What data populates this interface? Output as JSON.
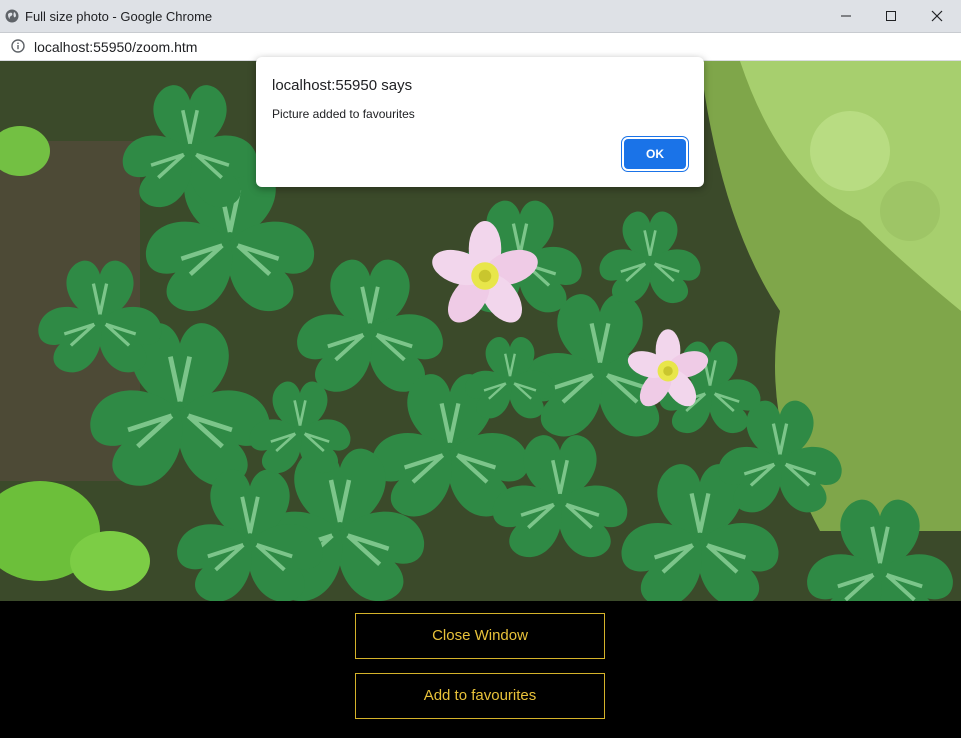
{
  "window": {
    "title": "Full size photo - Google Chrome",
    "url": "localhost:55950/zoom.htm"
  },
  "icons": {
    "favicon": "globe-icon",
    "info": "info-icon",
    "minimize": "minimize-icon",
    "maximize": "maximize-icon",
    "close": "close-icon"
  },
  "photo": {
    "subject": "clover leaves with pink flowers"
  },
  "controls": {
    "close_label": "Close Window",
    "favourites_label": "Add to favourites",
    "accent_color": "#e8c23a"
  },
  "dialog": {
    "origin": "localhost:55950 says",
    "message": "Picture added to favourites",
    "ok_label": "OK",
    "ok_color": "#1a73e8"
  }
}
